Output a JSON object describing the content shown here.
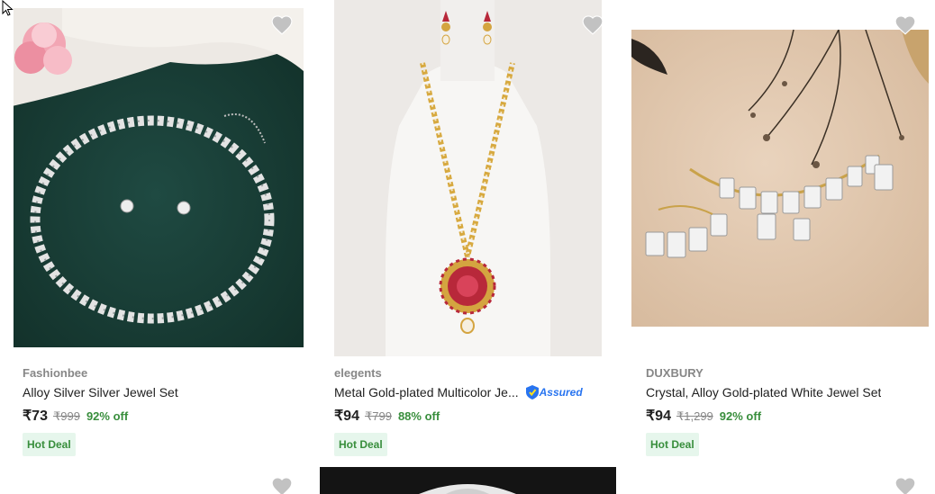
{
  "products": [
    {
      "brand": "Fashionbee",
      "title": "Alloy Silver Silver Jewel Set",
      "price": "₹73",
      "mrp": "₹999",
      "discount": "92% off",
      "deal": "Hot Deal",
      "assured": ""
    },
    {
      "brand": "elegents",
      "title": "Metal Gold-plated Multicolor Je...",
      "price": "₹94",
      "mrp": "₹799",
      "discount": "88% off",
      "deal": "Hot Deal",
      "assured": "Assured"
    },
    {
      "brand": "DUXBURY",
      "title": "Crystal, Alloy Gold-plated White Jewel Set",
      "price": "₹94",
      "mrp": "₹1,299",
      "discount": "92% off",
      "deal": "Hot Deal",
      "assured": ""
    }
  ],
  "colors": {
    "brand_green": "#388e3c",
    "deal_bg": "#e6f6ec",
    "assured_blue": "#2874f0",
    "heart": "#c2c2c2"
  },
  "icons": {
    "wishlist": "heart-icon",
    "assured": "flipkart-assured-icon",
    "cursor": "mouse-pointer-icon"
  }
}
